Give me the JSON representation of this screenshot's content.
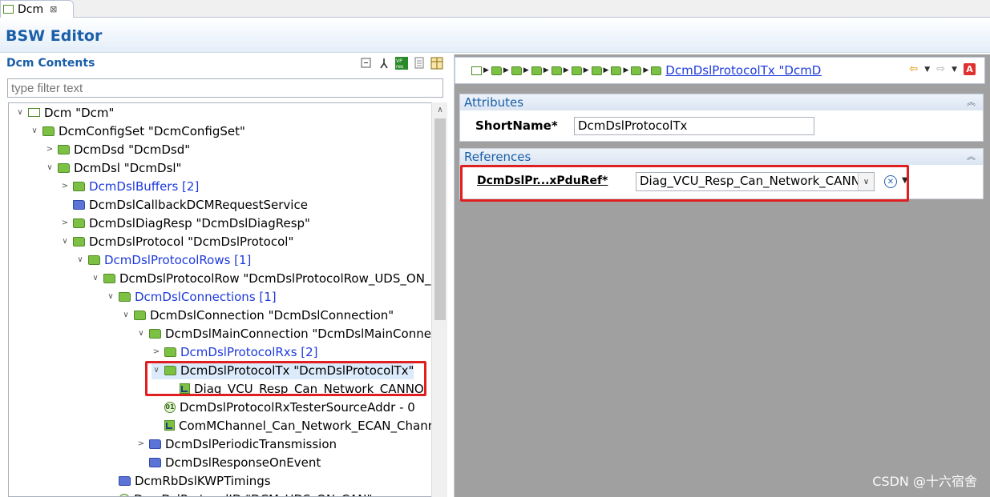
{
  "tab": {
    "label": "Dcm",
    "close": "⊠"
  },
  "header": {
    "title": "BSW Editor"
  },
  "left_panel": {
    "title": "Dcm Contents",
    "filter_placeholder": "type filter text",
    "tree": [
      {
        "label": "Dcm \"Dcm\"",
        "chevron": "∨",
        "icon": "box",
        "color": "black"
      },
      {
        "label": "DcmConfigSet \"DcmConfigSet\"",
        "chevron": "∨",
        "icon": "folder-green",
        "color": "black"
      },
      {
        "label": "DcmDsd \"DcmDsd\"",
        "chevron": ">",
        "icon": "folder-green",
        "color": "black"
      },
      {
        "label": "DcmDsl \"DcmDsl\"",
        "chevron": "∨",
        "icon": "folder-green",
        "color": "black"
      },
      {
        "label": "DcmDslBuffers [2]",
        "chevron": ">",
        "icon": "folder-green",
        "color": "blue"
      },
      {
        "label": "DcmDslCallbackDCMRequestService",
        "chevron": "",
        "icon": "folder-blue",
        "color": "black"
      },
      {
        "label": "DcmDslDiagResp \"DcmDslDiagResp\"",
        "chevron": ">",
        "icon": "folder-green",
        "color": "black"
      },
      {
        "label": "DcmDslProtocol \"DcmDslProtocol\"",
        "chevron": "∨",
        "icon": "folder-green",
        "color": "black"
      },
      {
        "label": "DcmDslProtocolRows [1]",
        "chevron": "∨",
        "icon": "folder-green",
        "color": "blue"
      },
      {
        "label": "DcmDslProtocolRow \"DcmDslProtocolRow_UDS_ON_",
        "chevron": "∨",
        "icon": "folder-green",
        "color": "black"
      },
      {
        "label": "DcmDslConnections [1]",
        "chevron": "∨",
        "icon": "folder-green",
        "color": "blue"
      },
      {
        "label": "DcmDslConnection \"DcmDslConnection\"",
        "chevron": "∨",
        "icon": "folder-green",
        "color": "black"
      },
      {
        "label": "DcmDslMainConnection \"DcmDslMainConne",
        "chevron": "∨",
        "icon": "folder-green",
        "color": "black"
      },
      {
        "label": "DcmDslProtocolRxs [2]",
        "chevron": ">",
        "icon": "folder-green",
        "color": "blue"
      },
      {
        "label": "DcmDslProtocolTx \"DcmDslProtocolTx\"",
        "chevron": "∨",
        "icon": "folder-green",
        "color": "black",
        "selected": true
      },
      {
        "label": "Diag_VCU_Resp_Can_Network_CANNOI",
        "chevron": "",
        "icon": "ref",
        "color": "black"
      },
      {
        "label": "DcmDslProtocolRxTesterSourceAddr - 0",
        "chevron": "",
        "icon": "num",
        "color": "black"
      },
      {
        "label": "ComMChannel_Can_Network_ECAN_Chanr",
        "chevron": "",
        "icon": "ref",
        "color": "black"
      },
      {
        "label": "DcmDslPeriodicTransmission",
        "chevron": ">",
        "icon": "folder-blue",
        "color": "black"
      },
      {
        "label": "DcmDslResponseOnEvent",
        "chevron": "",
        "icon": "folder-blue",
        "color": "black"
      },
      {
        "label": "DcmRbDslKWPTimings",
        "chevron": "",
        "icon": "folder-blue",
        "color": "black"
      },
      {
        "label": "DcmDslProtocolID \"DCM_UDS_ON_CAN\"",
        "chevron": "",
        "icon": "num",
        "color": "black"
      }
    ]
  },
  "right_panel": {
    "breadcrumb_link": "DcmDslProtocolTx \"DcmDs",
    "attributes": {
      "title": "Attributes",
      "label": "ShortName*",
      "value": "DcmDslProtocolTx"
    },
    "references": {
      "title": "References",
      "label": "DcmDslPr...xPduRef*",
      "value": "Diag_VCU_Resp_Can_Network_CANN"
    }
  },
  "watermark": "CSDN @十六宿舍"
}
